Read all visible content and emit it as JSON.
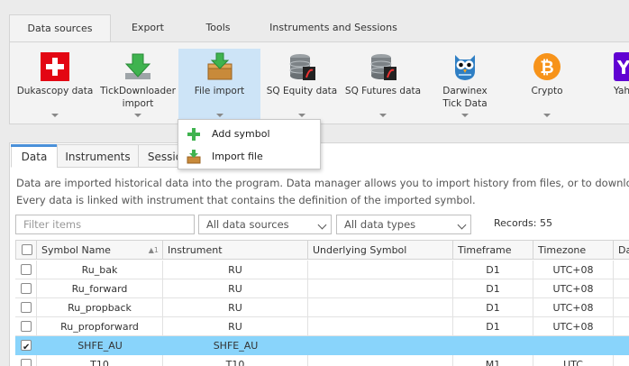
{
  "ribbon_tabs": [
    "Data sources",
    "Export",
    "Tools",
    "Instruments and Sessions"
  ],
  "ribbon_buttons": [
    {
      "label": "Dukascopy data",
      "icon": "swiss-flag-icon"
    },
    {
      "label": "TickDownloader import",
      "icon": "green-download-arrow-icon"
    },
    {
      "label": "File import",
      "icon": "file-import-box-icon"
    },
    {
      "label": "SQ Equity data",
      "icon": "database-icon"
    },
    {
      "label": "SQ Futures data",
      "icon": "database-icon"
    },
    {
      "label": "Darwinex Tick Data",
      "icon": "owl-icon"
    },
    {
      "label": "Crypto",
      "icon": "bitcoin-icon"
    },
    {
      "label": "Yah",
      "icon": "yahoo-icon"
    }
  ],
  "menu": {
    "items": [
      {
        "label": "Add symbol",
        "icon": "green-plus-icon"
      },
      {
        "label": "Import file",
        "icon": "file-import-icon"
      }
    ]
  },
  "content_tabs": [
    "Data",
    "Instruments",
    "Sessio"
  ],
  "description": {
    "line1": "Data are imported historical data into the program. Data manager allows you to import history from files, or to download i",
    "line2": "Every data is linked with instrument that contains the definition of the imported symbol."
  },
  "filter": {
    "placeholder": "Filter items"
  },
  "sources_select": "All data sources",
  "types_select": "All data types",
  "records": "Records: 55",
  "table": {
    "headers": [
      "Symbol Name",
      "Instrument",
      "Underlying Symbol",
      "Timeframe",
      "Timezone",
      "Da"
    ],
    "sort_indicator": "▲1",
    "rows": [
      {
        "symbol": "Ru_bak",
        "instrument": "RU",
        "underlying": "",
        "timeframe": "D1",
        "timezone": "UTC+08",
        "checked": false,
        "selected": false
      },
      {
        "symbol": "Ru_forward",
        "instrument": "RU",
        "underlying": "",
        "timeframe": "D1",
        "timezone": "UTC+08",
        "checked": false,
        "selected": false
      },
      {
        "symbol": "Ru_propback",
        "instrument": "RU",
        "underlying": "",
        "timeframe": "D1",
        "timezone": "UTC+08",
        "checked": false,
        "selected": false
      },
      {
        "symbol": "Ru_propforward",
        "instrument": "RU",
        "underlying": "",
        "timeframe": "D1",
        "timezone": "UTC+08",
        "checked": false,
        "selected": false
      },
      {
        "symbol": "SHFE_AU",
        "instrument": "SHFE_AU",
        "underlying": "",
        "timeframe": "",
        "timezone": "",
        "checked": true,
        "selected": true
      },
      {
        "symbol": "T10",
        "instrument": "T10",
        "underlying": "",
        "timeframe": "M1",
        "timezone": "UTC",
        "checked": false,
        "selected": false
      }
    ]
  }
}
